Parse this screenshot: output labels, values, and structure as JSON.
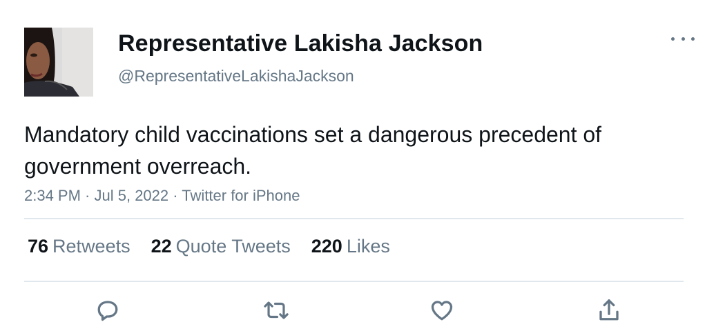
{
  "author": {
    "name": "Representative Lakisha Jackson",
    "handle": "@RepresentativeLakishaJackson"
  },
  "tweet": {
    "text": "Mandatory child vaccinations set a dangerous precedent of government overreach.",
    "time": "2:34 PM",
    "date": "Jul 5, 2022",
    "source": "Twitter for iPhone",
    "separator": " · "
  },
  "stats": {
    "retweets_count": "76",
    "retweets_label": "Retweets",
    "quotes_count": "22",
    "quotes_label": "Quote Tweets",
    "likes_count": "220",
    "likes_label": "Likes"
  },
  "icons": {
    "more": "more-horizontal-icon",
    "reply": "reply-icon",
    "retweet": "retweet-icon",
    "like": "heart-icon",
    "share": "share-icon"
  },
  "colors": {
    "text": "#0f1419",
    "secondary": "#657786",
    "divider": "#e1e8ed"
  }
}
